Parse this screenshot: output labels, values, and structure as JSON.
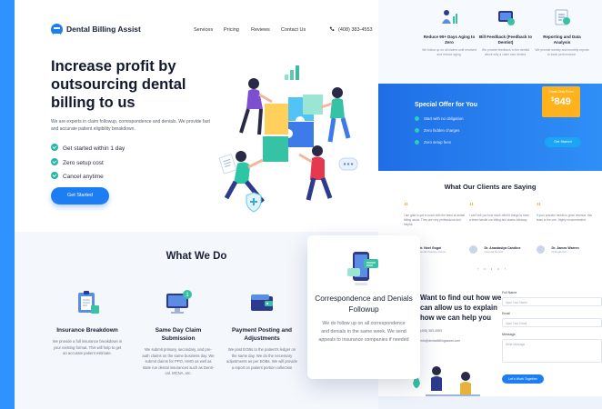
{
  "brand": {
    "name": "Dental Billing Assist"
  },
  "nav": {
    "links": [
      "Services",
      "Pricing",
      "Reviews",
      "Contact Us"
    ],
    "phone": "(408) 383-4553"
  },
  "hero": {
    "title": "Increase profit by outsourcing dental billing to us",
    "description": "We are experts in claim followup, correspondence and denials. We provide fast and accurate patient eligibility breakdown.",
    "checks": [
      "Get started within 1 day",
      "Zero setup cost",
      "Cancel anytime"
    ],
    "cta": "Get Started"
  },
  "what_we_do": {
    "title": "What We Do",
    "services": [
      {
        "title": "Insurance Breakdown",
        "desc": "We provide a full insurance breakdown in your existing format. This will help to get an accurate patient estimate."
      },
      {
        "title": "Same Day Claim Submission",
        "desc": "We submit primary, secondary, and pre-auth claims on the same business day. We submit claims for PPO, HMO as well as state run dental insurances such as Denti-cal, MCNA, etc."
      },
      {
        "title": "Payment Posting and Adjustments",
        "desc": "We post EOBs to the patient's ledger on the same day. We do the necessary adjustments as per EOBs. We will provide a report on patient portion collection"
      }
    ],
    "featured": {
      "title": "Correspondence and Denials Followup",
      "desc": "We do follow up on all correspondence and denials in the same week. We send appeals to insurance companies if needed"
    }
  },
  "right_page": {
    "features": [
      {
        "title": "Reduce 90+ Days Aging to Zero",
        "desc": "We follow up on all claims until resolved and reduce aging."
      },
      {
        "title": "Bill Feedback (Feedback to Dentist)",
        "desc": "We provide feedback to the dentist about why a claim was denied."
      },
      {
        "title": "Reporting and Data Analysis",
        "desc": "We provide weekly and monthly reports to track performance."
      }
    ],
    "offer": {
      "title": "Special Offer for You",
      "items": [
        "Start with no obligation",
        "Zero hidden charges",
        "Zero setup fees"
      ],
      "price_label": "Starts Only From",
      "currency": "$",
      "price": "849",
      "button": "Get Started"
    },
    "clients": {
      "title": "What Our Clients are Saying",
      "reviews": [
        {
          "text": "I am glad to get in touch with the team at dental billing assist. They are very professional and helpful.",
          "name": "Dr. Neel Gogoi",
          "role": "Dental Practice Owner"
        },
        {
          "text": "I can't tell you how much relief it brings to have a team handle our billing and claims followup.",
          "name": "Dr. Anastasiya Caroline",
          "role": "General Dentist"
        },
        {
          "text": "If your practice needs to grow revenue, this team is the one. Highly recommended.",
          "name": "Dr. James Warren",
          "role": "Orthodontist"
        }
      ],
      "pager": [
        "‹",
        "•",
        "•",
        "•",
        "›"
      ]
    },
    "contact": {
      "heading": "Want to find out how we can allow us to explain how we can help you",
      "phone": "(408) 383-4553",
      "email": "info@dentalbillingassist.com",
      "form": {
        "name_label": "Full Name",
        "name_placeholder": "Input Your Name",
        "email_label": "Email",
        "email_placeholder": "Input Your Email",
        "message_label": "Message",
        "message_placeholder": "Write Message",
        "submit": "Let's Work Together"
      }
    }
  },
  "colors": {
    "primary": "#1d7df2",
    "accent": "#1fb7a4",
    "price": "#ffb21c"
  }
}
